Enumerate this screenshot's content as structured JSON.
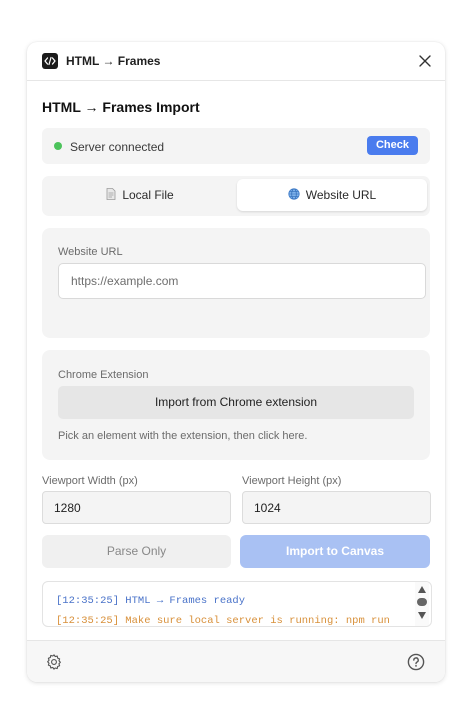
{
  "window": {
    "title": "HTML → Frames",
    "icon": "code-icon",
    "close_icon": "close-icon"
  },
  "heading": "HTML → Frames Import",
  "status": {
    "text": "Server connected",
    "dot_color": "#4cc35b",
    "check_label": "Check"
  },
  "tabs": [
    {
      "label": "Local File",
      "icon": "file-icon",
      "active": false
    },
    {
      "label": "Website URL",
      "icon": "globe-icon",
      "active": true
    }
  ],
  "website": {
    "label": "Website URL",
    "placeholder": "https://example.com",
    "value": ""
  },
  "extension": {
    "label": "Chrome Extension",
    "button_label": "Import from Chrome extension",
    "hint": "Pick an element with the extension, then click here."
  },
  "viewport": {
    "width_label": "Viewport Width (px)",
    "width_value": "1280",
    "height_label": "Viewport Height (px)",
    "height_value": "1024"
  },
  "actions": {
    "parse_label": "Parse Only",
    "import_label": "Import to Canvas"
  },
  "log": [
    {
      "text": "[12:35:25] HTML → Frames ready",
      "color": "#4a73c9"
    },
    {
      "text": "[12:35:25] Make sure local server is running: npm run",
      "color": "#d8903a"
    }
  ],
  "footer": {
    "settings_icon": "gear-icon",
    "help_icon": "help-icon"
  },
  "colors": {
    "accent": "#4a7cee",
    "accent_disabled": "#a9c1f3"
  }
}
